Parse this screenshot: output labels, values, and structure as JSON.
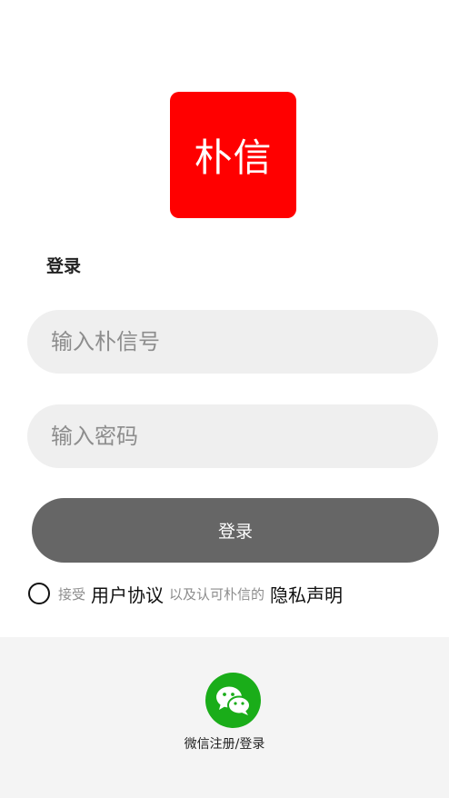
{
  "app": {
    "logo_text": "朴信",
    "logo_color": "#ff0000"
  },
  "login": {
    "title": "登录",
    "account_placeholder": "输入朴信号",
    "account_value": "",
    "password_placeholder": "输入密码",
    "password_value": "",
    "submit_label": "登录"
  },
  "agreement": {
    "checked": false,
    "prefix": "接受",
    "user_agreement": "用户协议",
    "middle": "以及认可朴信的",
    "privacy_policy": "隐私声明"
  },
  "wechat": {
    "icon": "wechat-icon",
    "label": "微信注册/登录",
    "color": "#1aad19"
  }
}
